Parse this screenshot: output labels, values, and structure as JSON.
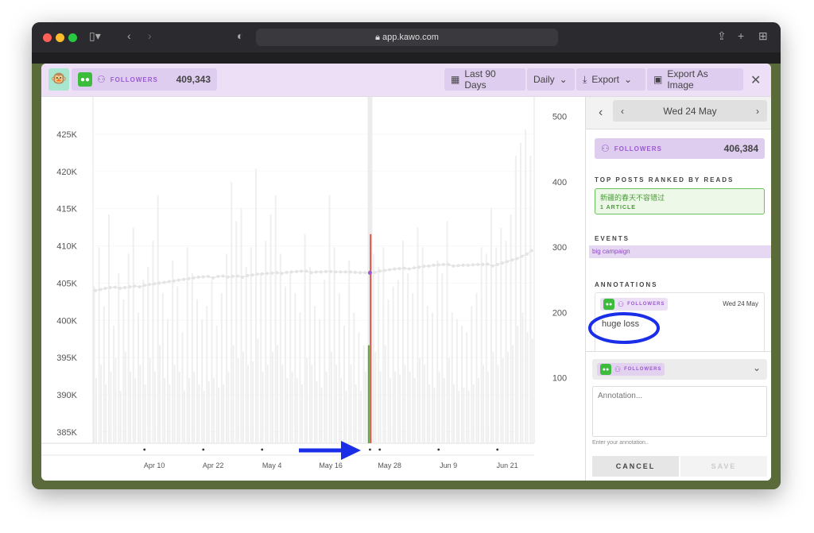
{
  "browser": {
    "url": "app.kawo.com"
  },
  "header": {
    "metric_label": "FOLLOWERS",
    "metric_value": "409,343",
    "range": "Last 90 Days",
    "interval": "Daily",
    "export": "Export",
    "export_image": "Export As Image"
  },
  "sidebar": {
    "date": "Wed 24 May",
    "metric_label": "FOLLOWERS",
    "metric_value": "406,384",
    "top_posts_title": "TOP POSTS RANKED BY READS",
    "post_title": "新疆的春天不容错过",
    "post_count": "1 ARTICLE",
    "events_title": "EVENTS",
    "event": "big campaign",
    "annotations_title": "ANNOTATIONS",
    "annotation_tag": "FOLLOWERS",
    "annotation_date": "Wed 24 May",
    "annotation_text": "huge loss",
    "new_tag": "FOLLOWERS",
    "placeholder": "Annotation...",
    "hint": "Enter your annotation..",
    "cancel": "CANCEL",
    "save": "SAVE"
  },
  "colors": {
    "accent": "#9b59d0",
    "selected_gain": "#5aa83a",
    "selected_loss": "#d9534f",
    "wechat": "#3dbb3d"
  },
  "chart_data": {
    "type": "bar+line",
    "left_ticks": [
      "385K",
      "390K",
      "395K",
      "400K",
      "405K",
      "410K",
      "415K",
      "420K",
      "425K"
    ],
    "right_ticks": [
      "100",
      "200",
      "300",
      "400",
      "500"
    ],
    "x_ticks": [
      "Apr 10",
      "Apr 22",
      "May 4",
      "May 16",
      "May 28",
      "Jun 9",
      "Jun 21"
    ],
    "ylim_left": [
      383500,
      430000
    ],
    "ylim_right": [
      0,
      530
    ],
    "selected": "May 24",
    "categories": [
      "Mar 29",
      "Mar 30",
      "Mar 31",
      "Apr 1",
      "Apr 2",
      "Apr 3",
      "Apr 4",
      "Apr 5",
      "Apr 6",
      "Apr 7",
      "Apr 8",
      "Apr 9",
      "Apr 10",
      "Apr 11",
      "Apr 12",
      "Apr 13",
      "Apr 14",
      "Apr 15",
      "Apr 16",
      "Apr 17",
      "Apr 18",
      "Apr 19",
      "Apr 20",
      "Apr 21",
      "Apr 22",
      "Apr 23",
      "Apr 24",
      "Apr 25",
      "Apr 26",
      "Apr 27",
      "Apr 28",
      "Apr 29",
      "Apr 30",
      "May 1",
      "May 2",
      "May 3",
      "May 4",
      "May 5",
      "May 6",
      "May 7",
      "May 8",
      "May 9",
      "May 10",
      "May 11",
      "May 12",
      "May 13",
      "May 14",
      "May 15",
      "May 16",
      "May 17",
      "May 18",
      "May 19",
      "May 20",
      "May 21",
      "May 22",
      "May 23",
      "May 24",
      "May 25",
      "May 26",
      "May 27",
      "May 28",
      "May 29",
      "May 30",
      "May 31",
      "Jun 1",
      "Jun 2",
      "Jun 3",
      "Jun 4",
      "Jun 5",
      "Jun 6",
      "Jun 7",
      "Jun 8",
      "Jun 9",
      "Jun 10",
      "Jun 11",
      "Jun 12",
      "Jun 13",
      "Jun 14",
      "Jun 15",
      "Jun 16",
      "Jun 17",
      "Jun 18",
      "Jun 19",
      "Jun 20",
      "Jun 21",
      "Jun 22",
      "Jun 23",
      "Jun 24",
      "Jun 25",
      "Jun 26"
    ],
    "followers": [
      404000,
      404150,
      404300,
      404400,
      404450,
      404300,
      404400,
      404500,
      404600,
      404500,
      404700,
      404800,
      404900,
      405000,
      405100,
      405200,
      405300,
      405400,
      405500,
      405600,
      405700,
      405800,
      405850,
      405900,
      405700,
      405900,
      405950,
      405800,
      405900,
      405950,
      405800,
      406000,
      406100,
      406200,
      406250,
      406300,
      406350,
      406400,
      406300,
      406450,
      406500,
      406550,
      406600,
      406600,
      406400,
      406500,
      406500,
      406550,
      406550,
      406500,
      406500,
      406500,
      406500,
      406450,
      406400,
      406400,
      406384,
      406450,
      406600,
      406700,
      406800,
      406900,
      406950,
      407000,
      406900,
      407050,
      407150,
      407250,
      407300,
      407400,
      407450,
      407500,
      407500,
      407300,
      407350,
      407400,
      407400,
      407450,
      407500,
      407500,
      407550,
      407300,
      407500,
      407700,
      407900,
      408100,
      408300,
      408600,
      408900,
      409343
    ],
    "series": [
      {
        "values": [
          240,
          300,
          210,
          350,
          180,
          260,
          220,
          290,
          330,
          200,
          250,
          270,
          310,
          380,
          230,
          190,
          280,
          240,
          170,
          300,
          260,
          220,
          190,
          210,
          250,
          180,
          230,
          290,
          400,
          340,
          360,
          270,
          300,
          420,
          260,
          310,
          350,
          380,
          290,
          240,
          260,
          230,
          200,
          320,
          270,
          210,
          190,
          250,
          380,
          300,
          230,
          180,
          280,
          200,
          170,
          150,
          150,
          290,
          270,
          300,
          220,
          240,
          250,
          310,
          260,
          230,
          330,
          300,
          210,
          200,
          280,
          260,
          340,
          200,
          190,
          180,
          170,
          210,
          230,
          300,
          290,
          360,
          300,
          330,
          310,
          350,
          440,
          460,
          480,
          440
        ]
      },
      {
        "values": [
          100,
          120,
          90,
          110,
          130,
          80,
          140,
          110,
          100,
          120,
          90,
          130,
          110,
          150,
          100,
          90,
          120,
          110,
          80,
          100,
          110,
          90,
          80,
          95,
          100,
          85,
          90,
          110,
          150,
          130,
          140,
          120,
          125,
          160,
          110,
          120,
          140,
          150,
          120,
          100,
          110,
          100,
          90,
          130,
          120,
          95,
          85,
          110,
          140,
          120,
          100,
          80,
          120,
          90,
          80,
          110,
          320,
          140,
          110,
          150,
          100,
          110,
          105,
          120,
          110,
          100,
          130,
          120,
          90,
          85,
          110,
          100,
          130,
          90,
          80,
          85,
          80,
          90,
          100,
          120,
          110,
          140,
          120,
          130,
          140,
          150,
          180,
          200,
          170,
          160
        ]
      }
    ]
  }
}
